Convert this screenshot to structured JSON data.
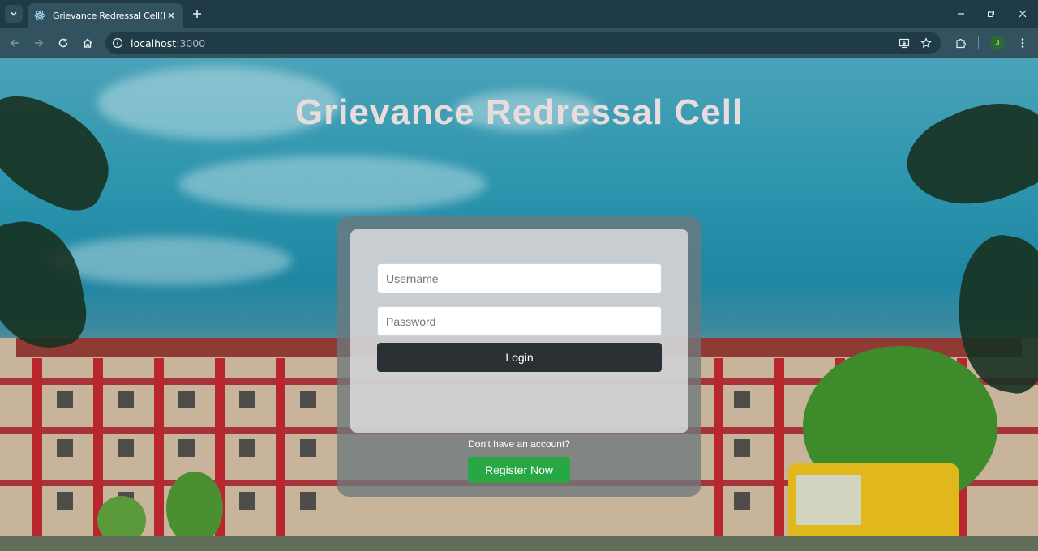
{
  "browser": {
    "tab": {
      "title": "Grievance Redressal Cell(NSS)",
      "favicon": "react-atom-icon"
    },
    "address": {
      "host": "localhost",
      "port": ":3000"
    },
    "profile_initial": "J",
    "colors": {
      "frame": "#1f3b48",
      "toolbar": "#33525f"
    }
  },
  "page": {
    "title": "Grievance Redressal Cell",
    "login_form": {
      "username_placeholder": "Username",
      "password_placeholder": "Password",
      "login_label": "Login"
    },
    "register_prompt": "Don't have an account?",
    "register_label": "Register Now",
    "colors": {
      "login_button": "#2b3035",
      "register_button": "#28a745",
      "title": "#e8dcdc"
    }
  }
}
